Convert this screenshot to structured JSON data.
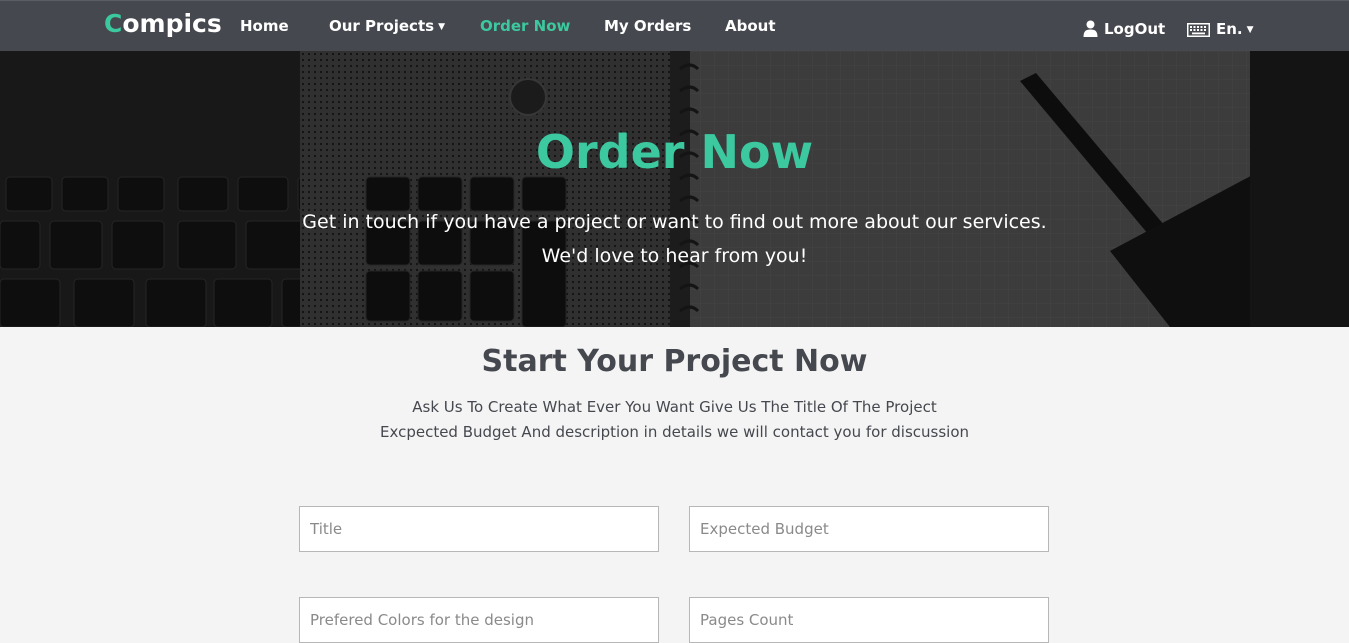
{
  "nav": {
    "brand_first": "C",
    "brand_rest": "ompics",
    "links": [
      {
        "label": "Home"
      },
      {
        "label": "Our Projects"
      },
      {
        "label": "Order Now"
      },
      {
        "label": "My Orders"
      },
      {
        "label": "About"
      }
    ],
    "logout_label": "LogOut",
    "language_label": "En.",
    "icons": {
      "user": "user-icon",
      "keyboard": "keyboard-icon",
      "caret": "caret-down-icon"
    }
  },
  "hero": {
    "title": "Order Now",
    "subtitle_line1": "Get in touch if you have a project or want to find out more about our services.",
    "subtitle_line2": "We'd love to hear from you!"
  },
  "main": {
    "title": "Start Your Project Now",
    "desc_line1": "Ask Us To Create What Ever You Want Give Us The Title Of The Project",
    "desc_line2": "Excpected Budget And description in details we will contact you for discussion"
  },
  "form": {
    "title_placeholder": "Title",
    "budget_placeholder": "Expected Budget",
    "colors_placeholder": "Prefered Colors for the design",
    "pages_placeholder": "Pages Count"
  },
  "colors": {
    "accent": "#3cc9a0",
    "navbar": "#45484e",
    "page_bg": "#f4f4f4"
  }
}
